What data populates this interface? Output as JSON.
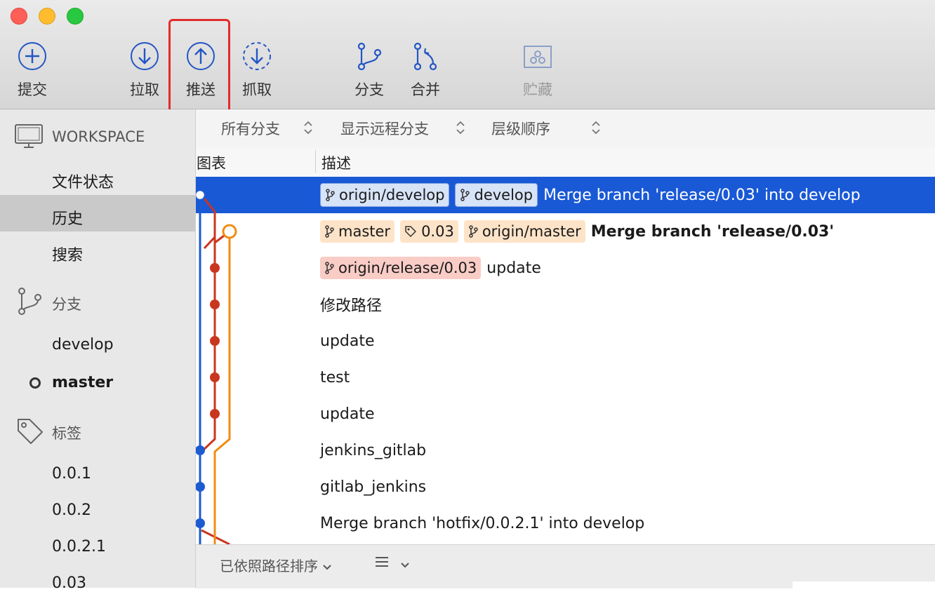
{
  "toolbar": {
    "commit": "提交",
    "pull": "拉取",
    "push": "推送",
    "fetch": "抓取",
    "branch": "分支",
    "merge": "合并",
    "stash": "贮藏"
  },
  "sidebar": {
    "workspace_header": "WORKSPACE",
    "workspace_items": [
      "文件状态",
      "历史",
      "搜索"
    ],
    "branches_header": "分支",
    "branches": [
      "develop",
      "master"
    ],
    "tags_header": "标签",
    "tags": [
      "0.0.1",
      "0.0.2",
      "0.0.2.1",
      "0.03"
    ]
  },
  "filters": {
    "branches": "所有分支",
    "remote": "显示远程分支",
    "order": "层级顺序"
  },
  "columns": {
    "graph": "图表",
    "description": "描述"
  },
  "commits": [
    {
      "tags": [
        "origin/develop",
        "develop"
      ],
      "message": "Merge branch 'release/0.03' into develop"
    },
    {
      "tags": [
        "master",
        "0.03",
        "origin/master"
      ],
      "message": "Merge branch 'release/0.03'"
    },
    {
      "tags": [
        "origin/release/0.03"
      ],
      "message": "update"
    },
    {
      "message": "修改路径"
    },
    {
      "message": "update"
    },
    {
      "message": "test"
    },
    {
      "message": "update"
    },
    {
      "message": "jenkins_gitlab"
    },
    {
      "message": "gitlab_jenkins"
    },
    {
      "message": "Merge branch 'hotfix/0.0.2.1' into develop"
    }
  ],
  "bottom": {
    "sort_label": "已依照路径排序"
  },
  "colors": {
    "selection": "#1959d6",
    "develop_line": "#1c5bd1",
    "release_line": "#c9361f",
    "master_line": "#f08c15",
    "highlight_box": "#e22b2b"
  }
}
